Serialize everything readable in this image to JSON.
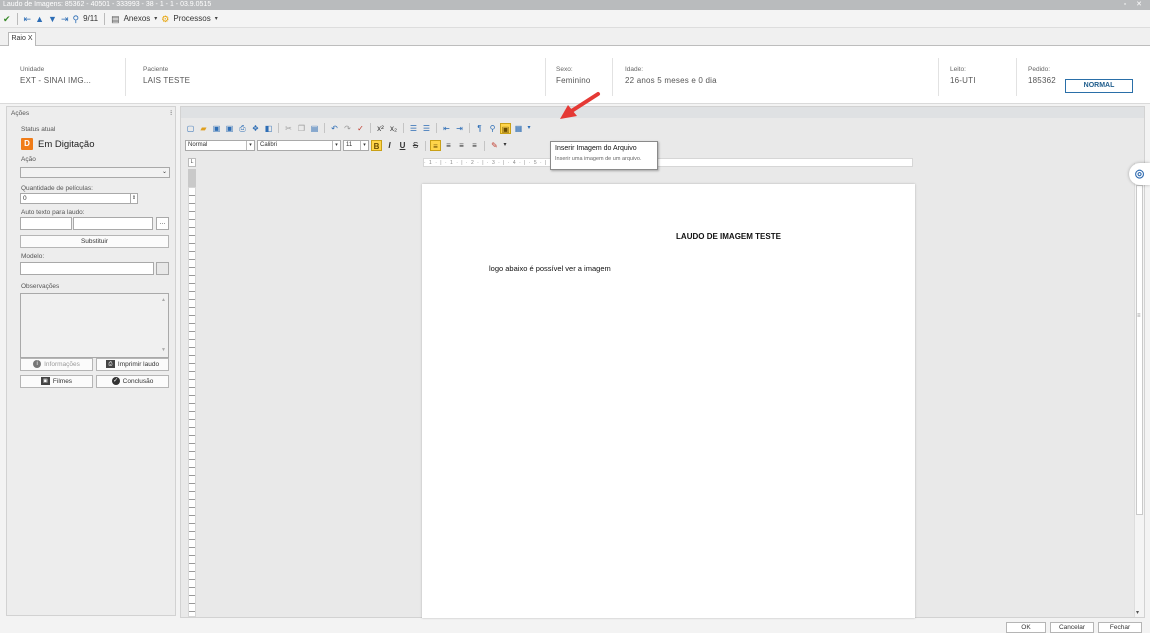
{
  "window": {
    "title": "Laudo de Imagens: 85362 - 40501 - 333993 - 38 - 1 - 1 - 03.9.0515",
    "controls": "▫ ✕"
  },
  "toolbar": {
    "page_counter": "9/11",
    "anexos_label": "Anexos",
    "processos_label": "Processos"
  },
  "tabs": [
    {
      "label": "Raio X"
    }
  ],
  "patient": {
    "unidade_label": "Unidade",
    "unidade_value": "EXT - SINAI IMG...",
    "paciente_label": "Paciente",
    "paciente_value": "LAIS TESTE",
    "sexo_label": "Sexo:",
    "sexo_value": "Feminino",
    "idade_label": "Idade:",
    "idade_value": "22 anos 5 meses e 0 dia",
    "leito_label": "Leito:",
    "leito_value": "16-UTI",
    "pedido_label": "Pedido:",
    "pedido_value": "185362",
    "priority_label": "NORMAL"
  },
  "left_panel": {
    "header": "Ações",
    "pin_icon": "⁝",
    "status_label": "Status atual",
    "status_letter": "D",
    "status_value": "Em Digitação",
    "acao_label": "Ação",
    "acao_value": "",
    "peliculas_label": "Quantidade de películas:",
    "peliculas_value": "0",
    "autotexto_label": "Auto texto para laudo:",
    "substituir_label": "Substituir",
    "modelo_label": "Modelo:",
    "observacoes_label": "Observações",
    "informacoes_label": "Informações",
    "imprimir_label": "Imprimir laudo",
    "filmes_label": "Filmes",
    "conclusao_label": "Conclusão"
  },
  "editor": {
    "style_value": "Normal",
    "font_value": "Calibri",
    "size_value": "11",
    "ruler_text": "· 1 · | · 1 · | · 2 · | · 3 · | · 4 · | · 5 · | · 6 · | · 7 ·",
    "doc_title": "LAUDO DE IMAGEM TESTE",
    "doc_line": "logo abaixo é possível ver a imagem"
  },
  "tooltip": {
    "title": "Inserir Imagem do Arquivo",
    "desc": "Inserir uma imagem de um arquivo."
  },
  "footer": {
    "ok_label": "OK",
    "cancel_label": "Cancelar",
    "close_label": "Fechar"
  },
  "colors": {
    "accent": "#2a6fa8",
    "status_orange": "#f07c18",
    "highlight_yellow": "#ffd54a",
    "arrow_red": "#e53935"
  }
}
